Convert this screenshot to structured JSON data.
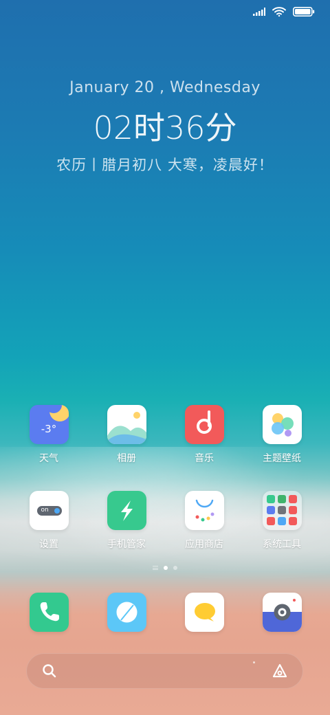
{
  "clock": {
    "date": "January  20 , Wednesday",
    "time": "02时36分",
    "lunar": "农历丨腊月初八 大寒，凌晨好！"
  },
  "apps_row1": [
    {
      "label": "天气",
      "temp": "-3°"
    },
    {
      "label": "相册"
    },
    {
      "label": "音乐"
    },
    {
      "label": "主题壁纸"
    }
  ],
  "apps_row2": [
    {
      "label": "设置",
      "toggle_text": "on"
    },
    {
      "label": "手机管家"
    },
    {
      "label": "应用商店"
    },
    {
      "label": "系统工具"
    }
  ],
  "dock": [
    "phone",
    "messages",
    "chat",
    "camera"
  ],
  "colors": {
    "weather": "#5b7cf0",
    "music": "#f25a5a",
    "security": "#37c98e",
    "phone": "#33c98f",
    "messages": "#5cc7f7",
    "chat": "#ffcc33",
    "camera": "#4f67d8"
  }
}
